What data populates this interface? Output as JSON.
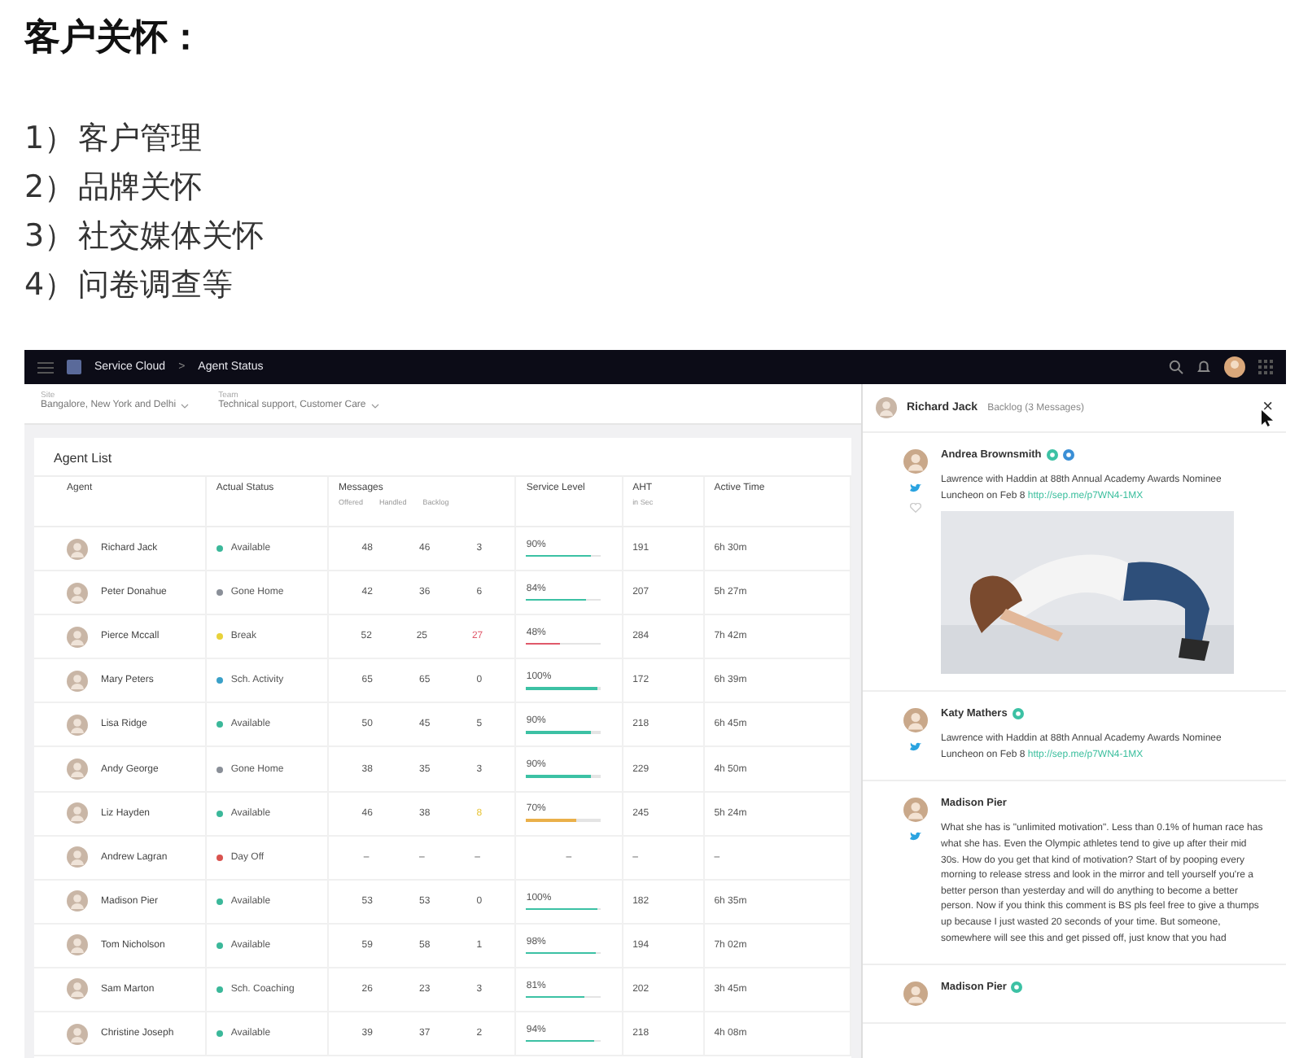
{
  "article": {
    "heading": "客户关怀：",
    "items": [
      {
        "num": "1）",
        "text": "客户管理"
      },
      {
        "num": "2）",
        "text": "品牌关怀"
      },
      {
        "num": "3）",
        "text": "社交媒体关怀"
      },
      {
        "num": "4）",
        "text": "问卷调查等"
      }
    ]
  },
  "app": {
    "breadcrumb": [
      "Service Cloud",
      "Agent Status"
    ],
    "separator": ">",
    "filters": [
      {
        "label": "Site",
        "value": "Bangalore, New York and Delhi"
      },
      {
        "label": "Team",
        "value": "Technical support, Customer Care"
      }
    ],
    "list_title": "Agent List",
    "columns": [
      {
        "label": "Agent"
      },
      {
        "label": "Actual Status"
      },
      {
        "label": "Messages",
        "sub": [
          "Offered",
          "Handled",
          "Backlog"
        ]
      },
      {
        "label": "Service Level"
      },
      {
        "label": "AHT",
        "sub": [
          "in Sec"
        ]
      },
      {
        "label": "Active Time"
      }
    ],
    "rows": [
      {
        "name": "Richard Jack",
        "status": "Available",
        "color": "#3bb89a",
        "offered": "48",
        "handled": "46",
        "backlog": "3",
        "service": "90%",
        "level": 0.9,
        "aht": "191",
        "active": "6h 30m"
      },
      {
        "name": "Peter Donahue",
        "status": "Gone Home",
        "color": "#8a8f98",
        "offered": "42",
        "handled": "36",
        "backlog": "6",
        "service": "84%",
        "level": 0.84,
        "aht": "207",
        "active": "5h 27m"
      },
      {
        "name": "Pierce Mccall",
        "status": "Break",
        "color": "#e8d23a",
        "offered": "52",
        "handled": "25",
        "backlog": {
          "text": "27",
          "kind": "alert"
        },
        "service": "48%",
        "level": 0.48,
        "aht": "284",
        "active": "7h 42m"
      },
      {
        "name": "Mary Peters",
        "status": "Sch. Activity",
        "color": "#3aa0c8",
        "offered": "65",
        "handled": "65",
        "backlog": "0",
        "service": "100%",
        "level": 1,
        "aht": "172",
        "active": "6h 39m"
      },
      {
        "name": "Lisa Ridge",
        "status": "Available",
        "color": "#3bb89a",
        "offered": "50",
        "handled": "45",
        "backlog": "5",
        "service": "90%",
        "level": 0.9,
        "aht": "218",
        "active": "6h 45m"
      },
      {
        "name": "Andy George",
        "status": "Gone Home",
        "color": "#8a8f98",
        "offered": "38",
        "handled": "35",
        "backlog": "3",
        "service": "90%",
        "level": 0.9,
        "aht": "229",
        "active": "4h 50m"
      },
      {
        "name": "Liz Hayden",
        "status": "Available",
        "color": "#3bb89a",
        "offered": "46",
        "handled": "38",
        "backlog": {
          "text": "8",
          "kind": "warning"
        },
        "service": "70%",
        "level": 0.7,
        "aht": "245",
        "active": "5h 24m"
      },
      {
        "name": "Andrew Lagran",
        "status": "Day Off",
        "color": "#d9534f",
        "offered": "–",
        "handled": "–",
        "backlog": "–",
        "service": "–",
        "aht": "–",
        "active": "–"
      },
      {
        "name": "Madison Pier",
        "status": "Available",
        "color": "#3bb89a",
        "offered": "53",
        "handled": "53",
        "backlog": "0",
        "service": "100%",
        "level": 1,
        "aht": "182",
        "active": "6h 35m"
      },
      {
        "name": "Tom Nicholson",
        "status": "Available",
        "color": "#3bb89a",
        "offered": "59",
        "handled": "58",
        "backlog": "1",
        "service": "98%",
        "level": 0.98,
        "aht": "194",
        "active": "7h 02m"
      },
      {
        "name": "Sam Marton",
        "status": "Sch. Coaching",
        "color": "#3bb89a",
        "offered": "26",
        "handled": "23",
        "backlog": "3",
        "service": "81%",
        "level": 0.81,
        "aht": "202",
        "active": "3h 45m"
      },
      {
        "name": "Christine Joseph",
        "status": "Available",
        "color": "#3bb89a",
        "offered": "39",
        "handled": "37",
        "backlog": "2",
        "service": "94%",
        "level": 0.94,
        "aht": "218",
        "active": "4h 08m"
      }
    ],
    "panel": {
      "agent": "Richard Jack",
      "backlog": "Backlog (3 Messages)",
      "close": "×",
      "messages": [
        {
          "author": "Andrea Brownsmith",
          "badges": [
            {
              "color": "#3cc1a4"
            },
            {
              "color": "#3a8fd6"
            }
          ],
          "liked": false,
          "text": "Lawrence with Haddin at 88th Annual Academy Awards Nominee Luncheon on Feb 8",
          "link": "http://sep.me/p7WN4-1MX",
          "media": {
            "kind": "picture"
          }
        },
        {
          "author": "Katy Mathers",
          "badges": [
            {
              "color": "#3cc1a4"
            }
          ],
          "text": "Lawrence with Haddin at 88th Annual Academy Awards Nominee Luncheon on Feb 8",
          "link": "http://sep.me/p7WN4-1MX"
        },
        {
          "author": "Madison Pier",
          "text": "What she has is \"unlimited motivation\". Less than 0.1% of human race has what she has. Even the Olympic athletes tend to give up after their mid 30s. How do you get that kind of motivation? Start of by pooping every morning to release stress and look in the mirror and tell yourself you're a better person than yesterday and will do anything to become a better person. Now if you think this comment is BS pls feel free to give a thumps up because I just wasted 20 seconds of your time. But someone, somewhere will see this and get pissed off, just know that you had"
        },
        {
          "author": "Madison Pier",
          "badges": [
            {
              "color": "#3cc1a4"
            }
          ]
        }
      ]
    }
  }
}
